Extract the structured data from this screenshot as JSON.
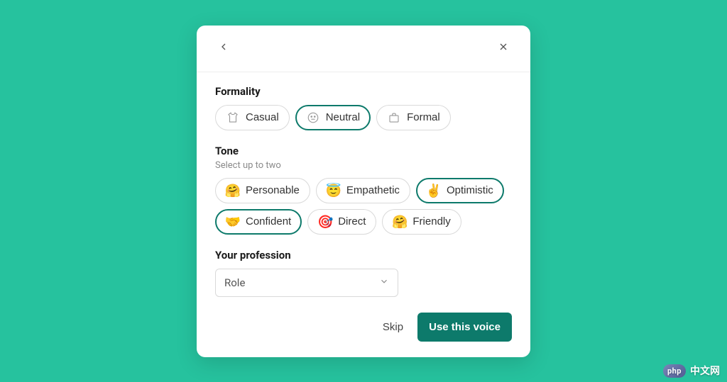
{
  "formality": {
    "label": "Formality",
    "options": [
      {
        "id": "casual",
        "label": "Casual",
        "selected": false
      },
      {
        "id": "neutral",
        "label": "Neutral",
        "selected": true
      },
      {
        "id": "formal",
        "label": "Formal",
        "selected": false
      }
    ]
  },
  "tone": {
    "label": "Tone",
    "sublabel": "Select up to two",
    "options": [
      {
        "id": "personable",
        "label": "Personable",
        "emoji": "🤗",
        "selected": false
      },
      {
        "id": "empathetic",
        "label": "Empathetic",
        "emoji": "😇",
        "selected": false
      },
      {
        "id": "optimistic",
        "label": "Optimistic",
        "emoji": "✌️",
        "selected": true
      },
      {
        "id": "confident",
        "label": "Confident",
        "emoji": "🤝",
        "selected": true
      },
      {
        "id": "direct",
        "label": "Direct",
        "emoji": "🎯",
        "selected": false
      },
      {
        "id": "friendly",
        "label": "Friendly",
        "emoji": "🤗",
        "selected": false
      }
    ]
  },
  "profession": {
    "label": "Your profession",
    "placeholder": "Role"
  },
  "footer": {
    "skip": "Skip",
    "primary": "Use this voice"
  },
  "watermark": {
    "logo": "php",
    "text": "中文网"
  }
}
